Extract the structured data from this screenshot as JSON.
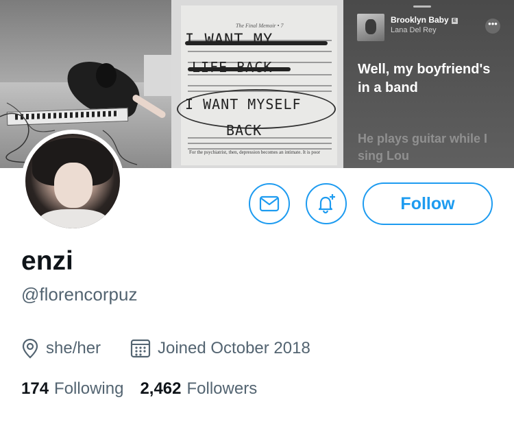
{
  "banner": {
    "book": {
      "header": "The Final Memoir  •  7",
      "handwriting": [
        "I WANT MY",
        "LIFE BACK",
        "I WANT MYSELF",
        "BACK"
      ],
      "footer": "For the psychiatrist, then, depression becomes an intimate. It is poor"
    },
    "music": {
      "song_title": "Brooklyn Baby",
      "explicit_badge": "E",
      "artist": "Lana Del Rey",
      "more_icon": "•••",
      "lyric_current": "Well, my boyfriend's in a band",
      "lyric_next": "He plays guitar while I sing Lou"
    }
  },
  "actions": {
    "message_icon": "envelope-icon",
    "notify_icon": "bell-plus-icon",
    "follow_label": "Follow"
  },
  "profile": {
    "display_name": "enzi",
    "handle": "@florencorpuz",
    "pronouns": "she/her",
    "joined": "Joined October 2018",
    "following_count": "174",
    "following_label": "Following",
    "followers_count": "2,462",
    "followers_label": "Followers"
  },
  "colors": {
    "accent": "#1d9bf0",
    "text_primary": "#0f1419",
    "text_secondary": "#536471"
  }
}
